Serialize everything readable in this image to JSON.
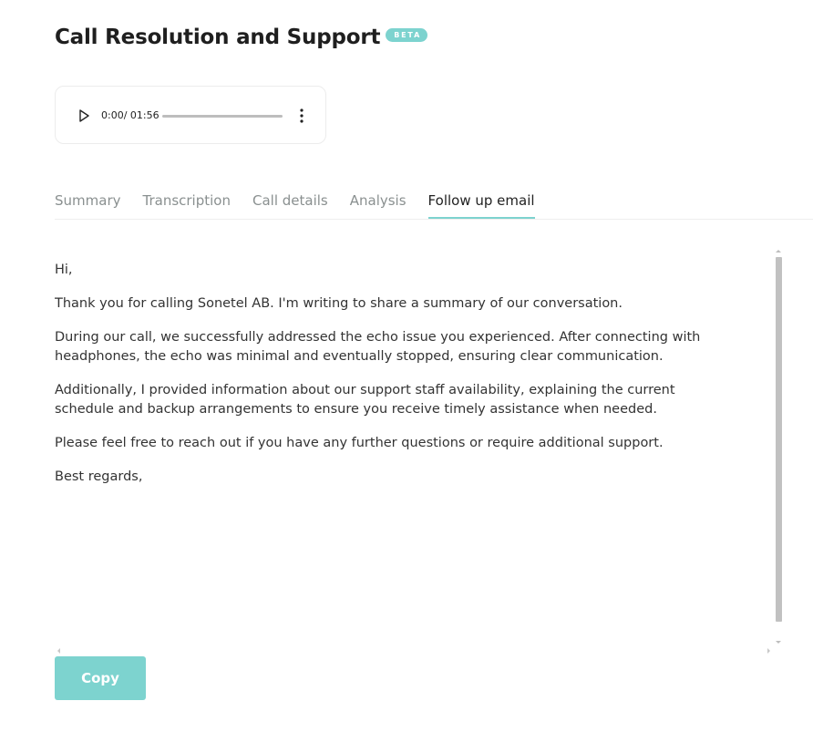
{
  "header": {
    "title": "Call Resolution and Support",
    "badge": "BETA"
  },
  "player": {
    "time": "0:00/ 01:56",
    "progress": 0,
    "play_icon": "play-icon",
    "menu_icon": "more-vertical-icon"
  },
  "tabs": [
    {
      "label": "Summary",
      "active": false
    },
    {
      "label": "Transcription",
      "active": false
    },
    {
      "label": "Call details",
      "active": false
    },
    {
      "label": "Analysis",
      "active": false
    },
    {
      "label": "Follow up email",
      "active": true
    }
  ],
  "email": {
    "paragraphs": [
      "Hi,",
      "Thank you for calling Sonetel AB. I'm writing to share a summary of our conversation.",
      "During our call, we successfully addressed the echo issue you experienced. After connecting with headphones, the echo was minimal and eventually stopped, ensuring clear communication.",
      "Additionally, I provided information about our support staff availability, explaining the current schedule and backup arrangements to ensure you receive timely assistance when needed.",
      "Please feel free to reach out if you have any further questions or require additional support.",
      "Best regards,"
    ]
  },
  "actions": {
    "copy_label": "Copy"
  },
  "colors": {
    "accent": "#7dd3cf",
    "tab_inactive": "#8a9090",
    "text": "#333333"
  }
}
